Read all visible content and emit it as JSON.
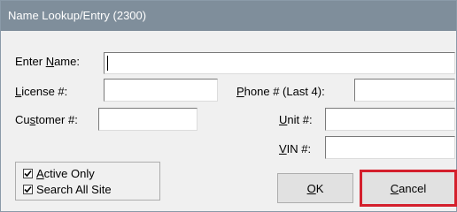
{
  "window": {
    "title": "Name Lookup/Entry (2300)"
  },
  "form": {
    "enter_name": {
      "pre": "Enter ",
      "acc": "N",
      "post": "ame:",
      "value": ""
    },
    "license": {
      "pre": "",
      "acc": "L",
      "post": "icense #:",
      "value": ""
    },
    "customer": {
      "pre": "Cu",
      "acc": "s",
      "post": "tomer #:",
      "value": ""
    },
    "phone": {
      "pre": "",
      "acc": "P",
      "post": "hone # (Last 4):",
      "value": ""
    },
    "unit": {
      "pre": "",
      "acc": "U",
      "post": "nit #:",
      "value": ""
    },
    "vin": {
      "pre": "",
      "acc": "V",
      "post": "IN #:",
      "value": ""
    }
  },
  "options": {
    "active_only": {
      "pre": "",
      "acc": "A",
      "post": "ctive Only",
      "checked": true
    },
    "search_all_site": {
      "label": "Search All Site",
      "checked": true
    }
  },
  "buttons": {
    "ok": {
      "pre": "",
      "acc": "O",
      "post": "K"
    },
    "cancel": {
      "pre": "",
      "acc": "C",
      "post": "ancel"
    }
  }
}
